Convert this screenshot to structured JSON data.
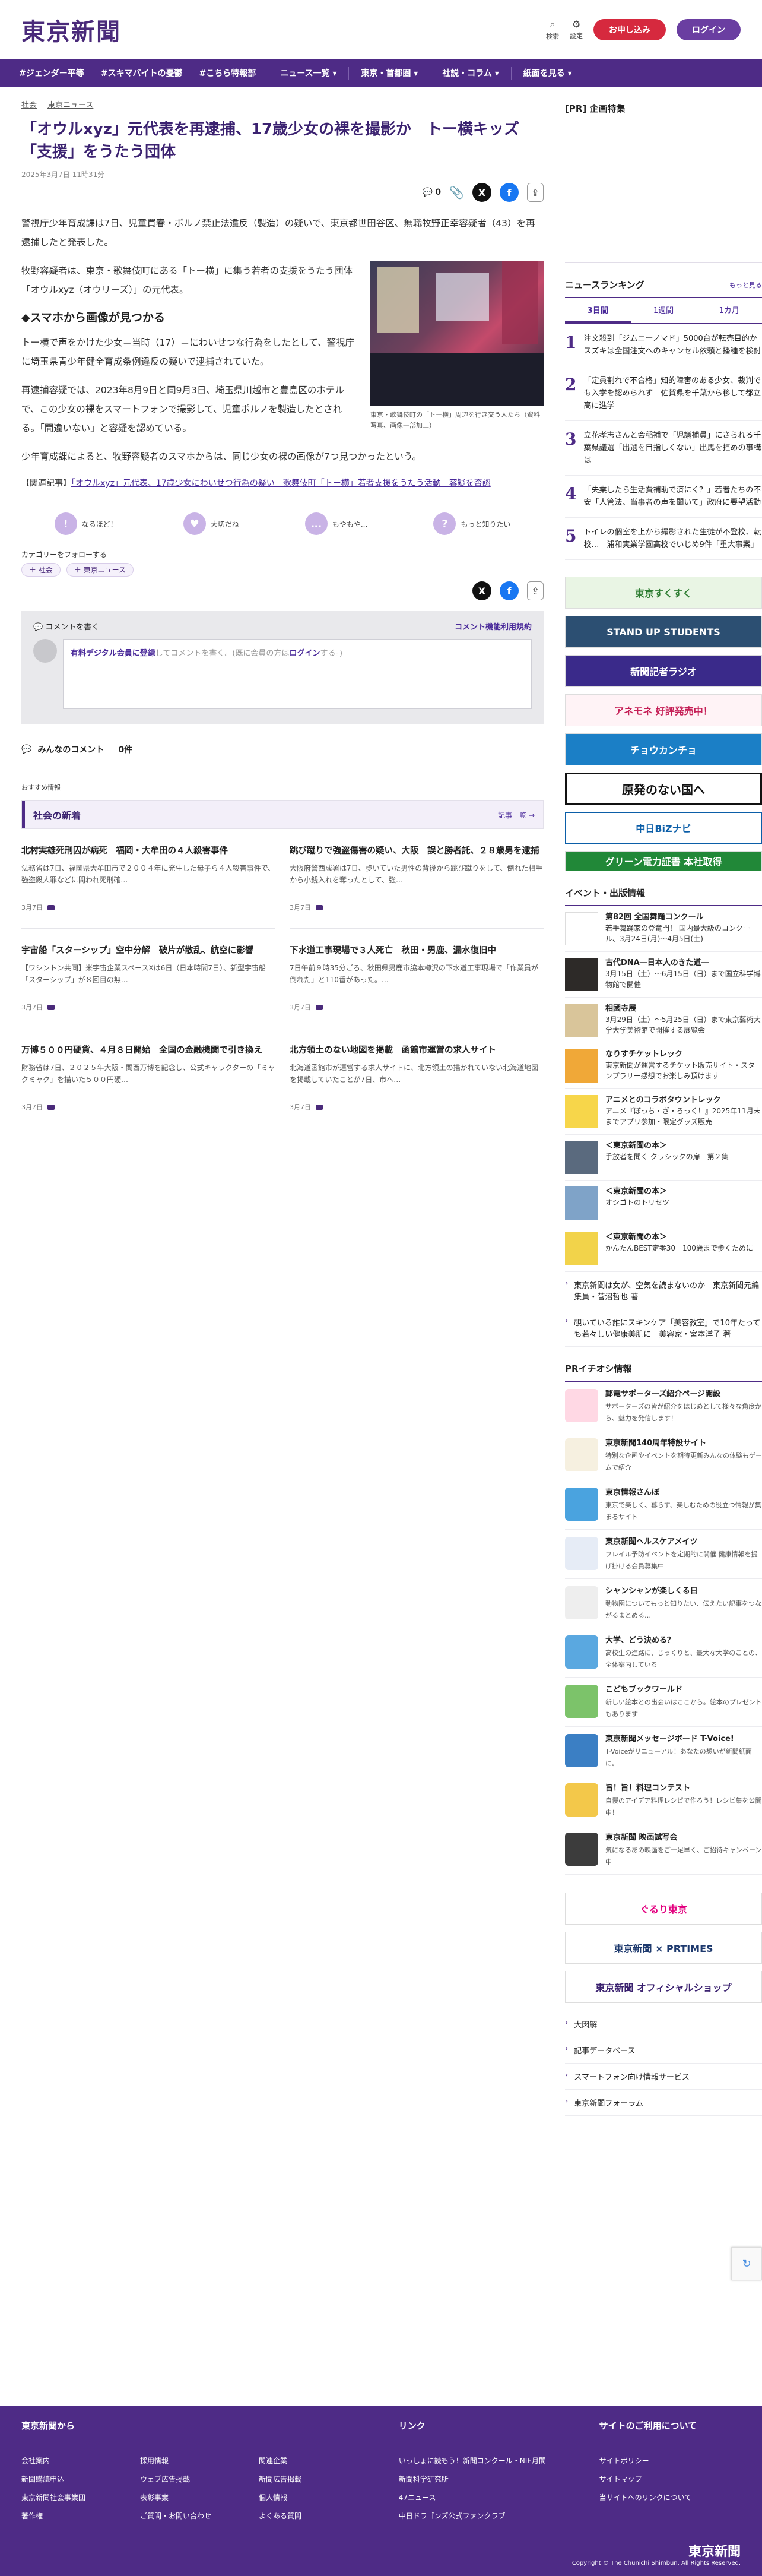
{
  "header": {
    "logo": "東京新聞",
    "search_label": "検索",
    "settings_label": "設定",
    "subscribe_label": "お申し込み",
    "login_label": "ログイン"
  },
  "nav": {
    "items": [
      "#ジェンダー平等",
      "#スキマバイトの憂鬱",
      "#こちら特報部",
      "ニュース一覧 ▾",
      "東京・首都圏 ▾",
      "社説・コラム ▾",
      "紙面を見る ▾"
    ]
  },
  "article": {
    "breadcrumb": [
      "社会",
      "東京ニュース"
    ],
    "title": "「オウルxyz」元代表を再逮捕、17歳少女の裸を撮影か　トー横キッズ「支援」をうたう団体",
    "date": "2025年3月7日 11時31分",
    "comment_count": "0",
    "p1": "警視庁少年育成課は7日、児童買春・ポルノ禁止法違反（製造）の疑いで、東京都世田谷区、無職牧野正幸容疑者（43）を再逮捕したと発表した。",
    "p2": "牧野容疑者は、東京・歌舞伎町にある「トー横」に集う若者の支援をうたう団体「オウルxyz（オウリーズ）」の元代表。",
    "photo_caption": "東京・歌舞伎町の「トー横」周辺を行き交う人たち（資料写真、画像一部加工）",
    "h2": "◆スマホから画像が見つかる",
    "p3": "トー横で声をかけた少女＝当時（17）＝にわいせつな行為をしたとして、警視庁に埼玉県青少年健全育成条例違反の疑いで逮捕されていた。",
    "p4": "再逮捕容疑では、2023年8月9日と同9月3日、埼玉県川越市と豊島区のホテルで、この少女の裸をスマートフォンで撮影して、児童ポルノを製造したとされる。「間違いない」と容疑を認めている。",
    "p5": "少年育成課によると、牧野容疑者のスマホからは、同じ少女の裸の画像が7つ見つかったという。",
    "related_prefix": "【関連記事】",
    "related_link": "「オウルxyz」元代表、17歳少女にわいせつ行為の疑い　歌舞伎町「トー横」若者支援をうたう活動　容疑を否認"
  },
  "reactions": [
    {
      "icon": "!",
      "label": "なるほど！"
    },
    {
      "icon": "♥",
      "label": "大切だね"
    },
    {
      "icon": "…",
      "label": "もやもや..."
    },
    {
      "icon": "?",
      "label": "もっと知りたい"
    }
  ],
  "follow": {
    "label": "カテゴリーをフォローする",
    "tags": [
      "＋ 社会",
      "＋ 東京ニュース"
    ]
  },
  "comments": {
    "write_label": "コメントを書く",
    "rules_label": "コメント機能利用規約",
    "prompt_member": "有料デジタル会員に登録",
    "prompt_mid": "してコメントを書く。(既に会員の方は",
    "prompt_login": "ログイン",
    "prompt_end": "する。)",
    "everyone_label": "みんなのコメント",
    "count": "0件"
  },
  "recommend_label": "おすすめ情報",
  "social_news": {
    "title": "社会の新着",
    "more": "記事一覧",
    "items": [
      {
        "title": "北村実雄死刑囚が病死　福岡・大牟田の４人殺害事件",
        "summary": "法務省は7日、福岡県大牟田市で２００４年に発生した母子ら４人殺害事件で、強盗殺人罪などに問われ死刑確…",
        "date": "3月7日"
      },
      {
        "title": "跳び蹴りで強盗傷害の疑い、大阪　誤と勝者託、２８歳男を逮捕",
        "summary": "大阪府警西成署は7日、歩いていた男性の背後から跳び蹴りをして、倒れた相手から小銭入れを奪ったとして、強…",
        "date": "3月7日"
      },
      {
        "title": "宇宙船「スターシップ」空中分解　破片が散乱、航空に影響",
        "summary": "【ワシントン共同】米宇宙企業スペースXは6日（日本時間7日）、新型宇宙船「スターシップ」が８回目の無…",
        "date": "3月7日"
      },
      {
        "title": "下水道工事現場で３人死亡　秋田・男鹿、漏水復旧中",
        "summary": "7日午前９時35分ごろ、秋田県男鹿市脇本樽沢の下水道工事現場で「作業員が倒れた」と110番があった。…",
        "date": "3月7日"
      },
      {
        "title": "万博５００円硬貨、４月８日開始　全国の金融機関で引き換え",
        "summary": "財務省は7日、２０２５年大阪・関西万博を記念し、公式キャラクターの「ミャクミャク」を描いた５００円硬…",
        "date": "3月7日"
      },
      {
        "title": "北方領土のない地図を掲載　函館市運営の求人サイト",
        "summary": "北海道函館市が運営する求人サイトに、北方領土の描かれていない北海道地図を掲載していたことが7日、市へ…",
        "date": "3月7日"
      }
    ]
  },
  "sidebar": {
    "pr_title": "[PR] 企画特集",
    "ranking_title": "ニュースランキング",
    "ranking_more": "もっと見る",
    "ranking_tabs": [
      "3日間",
      "1週間",
      "1カ月"
    ],
    "ranking": [
      {
        "num": "1",
        "text": "注文殺到「ジムニーノマド」5000台が転売目的か　スズキは全国注文へのキャンセル依頼と播種を検討"
      },
      {
        "num": "2",
        "text": "「定員割れで不合格」知的障害のある少女、裁判でも入学を認められず　佐賀県を千葉から移して都立高に進学"
      },
      {
        "num": "3",
        "text": "立花孝志さんと会稲補で「児議補員」にさられる千葉県議選「出選を目指しくない」出馬を拒めの事構は"
      },
      {
        "num": "4",
        "text": "「失業したら生活費補助で済にく？」若者たちの不安「人管法、当事者の声を聞いて」政府に要望活動"
      },
      {
        "num": "5",
        "text": "トイレの個室を上から撮影された生徒が不登校、転校…　浦和実業学園高校でいじめ9件「重大事案」"
      }
    ],
    "banners": [
      "東京すくすく",
      "STAND UP STUDENTS",
      "新聞記者ラジオ",
      "アネモネ 好評発売中！",
      "チョウカンチョ",
      "原発のない国へ",
      "中日BiZナビ",
      "グリーン電力証書 本社取得"
    ],
    "events_title": "イベント・出版情報",
    "events": [
      {
        "title": "第82回 全国舞踊コンクール",
        "text": "若手舞踊家の登竜門！ 国内最大級のコンクール、3月24日(月)～4月5日(土)"
      },
      {
        "title": "古代DNA―日本人のきた道―",
        "text": "3月15日（土）～6月15日（日）まで国立科学博物館で開催"
      },
      {
        "title": "相國寺展",
        "text": "3月29日（土）～5月25日（日）まで東京藝術大学大学美術館で開催する展覧会"
      },
      {
        "title": "なりすチケットレック",
        "text": "東京新聞が運営するチケット販売サイト・スタンプラリー感想でお楽しみ頂けます"
      },
      {
        "title": "アニメとのコラボタウントレック",
        "text": "アニメ『ぼっち・ざ・ろっく！』2025年11月未までアプリ参加・限定グッズ販売"
      },
      {
        "title": "＜東京新聞の本＞",
        "text": "手放者を聞く クラシックの扉　第２集"
      },
      {
        "title": "＜東京新聞の本＞",
        "text": "オシゴトのトリセツ"
      },
      {
        "title": "＜東京新聞の本＞",
        "text": "かんたんBEST定番30　100歳まで歩くために"
      }
    ],
    "books_extra": [
      "東京新聞は女が、空気を読まないのか　東京新聞元編集員・菅沼哲也 著",
      "覗いている誰にスキンケア「美容教室」で10年たっても若々しい健康美肌に　美容家・宮本洋子 著"
    ],
    "pr_info_title": "PRイチオシ情報",
    "pr_items": [
      {
        "title": "郵電サポーターズ紹介ページ開設",
        "text": "サポーターズの皆が紹介をはじめとして様々な角度から、魅力を発信します！"
      },
      {
        "title": "東京新聞140周年特設サイト",
        "text": "特別な企画やイベントを期待更新みんなの体験もゲームで紹介"
      },
      {
        "title": "東京情報さんぽ",
        "text": "東京で楽しく、暮らす、楽しむための役立つ情報が集まるサイト"
      },
      {
        "title": "東京新聞ヘルスケアメイツ",
        "text": "フレイル予防イベントを定期的に開催 健康情報を提げ掛ける会員募集中"
      },
      {
        "title": "シャンシャンが楽しくる日",
        "text": "動物園についてもっと知りたい、伝えたい記事をつながるまとめる…"
      },
      {
        "title": "大学、どう決める？",
        "text": "高校生の進路に、じっくりと、最大な大学のことの、全体案内している"
      },
      {
        "title": "こどもブックワールド",
        "text": "新しい絵本との出会いはここから。絵本のプレゼントもあります"
      },
      {
        "title": "東京新聞メッセージボード T-Voice!",
        "text": "T-Voiceがリニューアル！あなたの想いが新聞紙面に。"
      },
      {
        "title": "旨！旨！料理コンテスト",
        "text": "自慢のアイデア料理レシピで作ろう！レシピ集を公開中！"
      },
      {
        "title": "東京新聞 映画試写会",
        "text": "気になるあの映画をご一足早く、ご招待キャンペーン中"
      }
    ],
    "bottom_banners": [
      "ぐるり東京",
      "東京新聞 × PRTIMES",
      "東京新聞 オフィシャルショップ"
    ],
    "links": [
      "大図解",
      "記事データベース",
      "スマートフォン向け情報サービス",
      "東京新聞フォーラム"
    ]
  },
  "footer": {
    "col1_title": "東京新聞から",
    "col1_links": [
      "会社案内",
      "採用情報",
      "関連企業",
      "新聞購読申込",
      "ウェブ広告掲載",
      "新聞広告掲載",
      "東京新聞社会事業団",
      "表彰事業",
      "個人情報",
      "著作権",
      "ご質問・お問い合わせ",
      "よくある質問"
    ],
    "col2_title": "リンク",
    "col2_links": [
      "いっしょに読もう！新聞コンクール・NIE月間",
      "新聞科学研究所",
      "47ニュース",
      "中日ドラゴンズ公式ファンクラブ"
    ],
    "col3_title": "サイトのご利用について",
    "col3_links": [
      "サイトポリシー",
      "サイトマップ",
      "当サイトへのリンクについて"
    ],
    "logo": "東京新聞",
    "copyright": "Copyright © The Chunichi Shimbun, All Rights Reserved."
  }
}
